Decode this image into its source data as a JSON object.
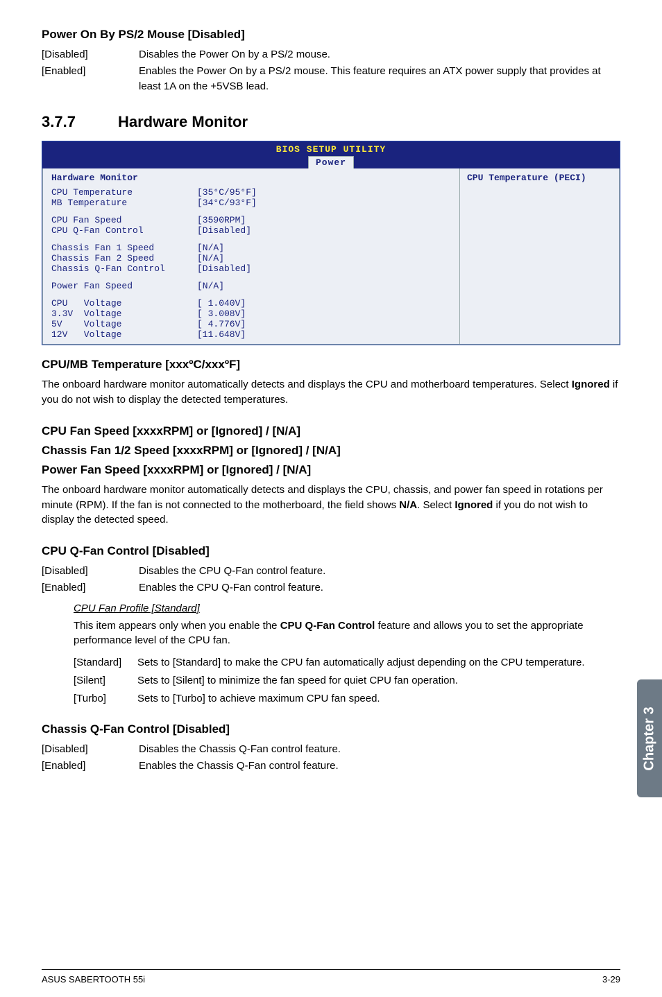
{
  "s1": {
    "title": "Power On By PS/2 Mouse [Disabled]",
    "rows": [
      {
        "term": "[Disabled]",
        "desc": "Disables the Power On by a PS/2 mouse."
      },
      {
        "term": "[Enabled]",
        "desc": "Enables the Power On by a PS/2 mouse. This feature requires an ATX power supply that provides at least 1A on the +5VSB lead."
      }
    ]
  },
  "hNum": "3.7.7",
  "hTitle": "Hardware Monitor",
  "bios": {
    "topTitle": "BIOS SETUP UTILITY",
    "tab": "Power",
    "leftHeader": "Hardware Monitor",
    "rightText": "CPU Temperature (PECI)",
    "groups": [
      [
        {
          "label": "CPU Temperature",
          "val": "[35°C/95°F]"
        },
        {
          "label": "MB Temperature",
          "val": "[34°C/93°F]"
        }
      ],
      [
        {
          "label": "CPU Fan Speed",
          "val": "[3590RPM]"
        },
        {
          "label": "CPU Q-Fan Control",
          "val": "[Disabled]"
        }
      ],
      [
        {
          "label": "Chassis Fan 1 Speed",
          "val": "[N/A]"
        },
        {
          "label": "Chassis Fan 2 Speed",
          "val": "[N/A]"
        },
        {
          "label": "Chassis Q-Fan Control",
          "val": "[Disabled]"
        }
      ],
      [
        {
          "label": "Power Fan Speed",
          "val": "[N/A]"
        }
      ],
      [
        {
          "label": "CPU   Voltage",
          "val": "[ 1.040V]"
        },
        {
          "label": "3.3V  Voltage",
          "val": "[ 3.008V]"
        },
        {
          "label": "5V    Voltage",
          "val": "[ 4.776V]"
        },
        {
          "label": "12V   Voltage",
          "val": "[11.648V]"
        }
      ]
    ]
  },
  "s2": {
    "title": "CPU/MB Temperature [xxxºC/xxxºF]",
    "para_a": "The onboard hardware monitor automatically detects and displays the CPU and motherboard temperatures. Select ",
    "para_b": "Ignored",
    "para_c": " if you do not wish to display the detected temperatures."
  },
  "s3": {
    "t1": "CPU Fan Speed [xxxxRPM] or [Ignored] / [N/A]",
    "t2": "Chassis Fan 1/2 Speed [xxxxRPM] or [Ignored] / [N/A]",
    "t3": "Power Fan Speed [xxxxRPM] or [Ignored] / [N/A]",
    "p_a": "The onboard hardware monitor automatically detects and displays the CPU, chassis, and power fan speed in rotations per minute (RPM). If the fan is not connected to the motherboard, the field shows ",
    "p_b": "N/A",
    "p_c": ". Select ",
    "p_d": "Ignored",
    "p_e": " if you do not wish to display the detected speed."
  },
  "s4": {
    "title": "CPU Q-Fan Control [Disabled]",
    "rows": [
      {
        "term": "[Disabled]",
        "desc": "Disables the CPU Q-Fan control feature."
      },
      {
        "term": "[Enabled]",
        "desc": "Enables the CPU Q-Fan control feature."
      }
    ],
    "sub": {
      "title": "CPU Fan Profile [Standard]",
      "p_a": "This item appears only when you enable the ",
      "p_b": "CPU Q-Fan Control",
      "p_c": " feature and allows you to set the appropriate performance level of the CPU fan.",
      "opts": [
        {
          "term": "[Standard]",
          "desc": "Sets to [Standard] to make the CPU fan automatically adjust depending on the CPU temperature."
        },
        {
          "term": "[Silent]",
          "desc": "Sets to [Silent] to minimize the fan speed for quiet CPU fan operation."
        },
        {
          "term": "[Turbo]",
          "desc": "Sets to [Turbo] to achieve maximum CPU fan speed."
        }
      ]
    }
  },
  "s5": {
    "title": "Chassis Q-Fan Control [Disabled]",
    "rows": [
      {
        "term": "[Disabled]",
        "desc": "Disables the Chassis Q-Fan control feature."
      },
      {
        "term": "[Enabled]",
        "desc": "Enables the Chassis Q-Fan control feature."
      }
    ]
  },
  "sideTab": "Chapter 3",
  "footer": {
    "left": "ASUS SABERTOOTH 55i",
    "right": "3-29"
  }
}
